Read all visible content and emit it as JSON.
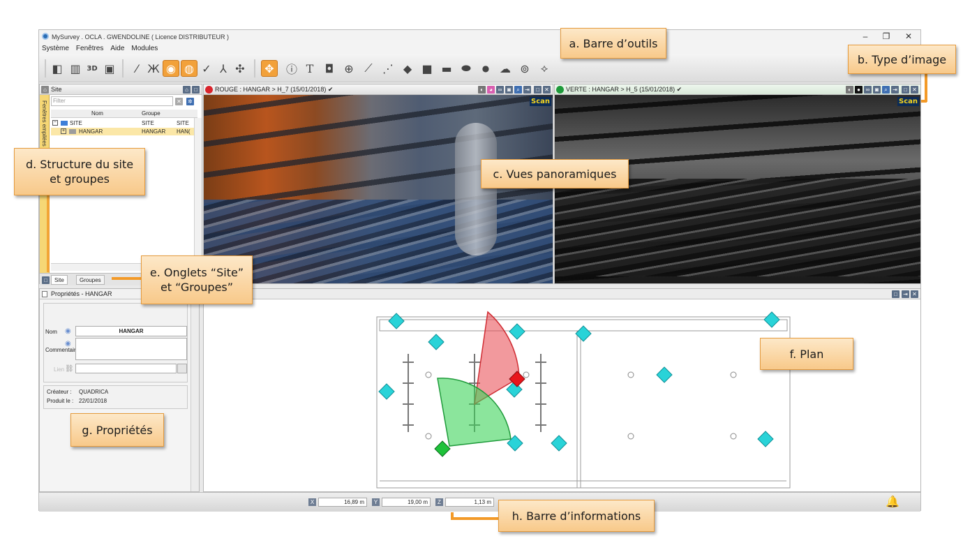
{
  "window": {
    "title": "MySurvey . OCLA . GWENDOLINE ( Licence DISTRIBUTEUR )",
    "controls": [
      "–",
      "❐",
      "✕"
    ]
  },
  "menu": [
    "Système",
    "Fenêtres",
    "Aide",
    "Modules"
  ],
  "site_panel": {
    "title": "Site",
    "strip_label": "Fenêtres empilées",
    "filter_placeholder": "Filter",
    "columns": [
      "Nom",
      "Groupe"
    ],
    "rows": [
      {
        "expander": "−",
        "name": "SITE",
        "group": "SITE",
        "extra": "SITE"
      },
      {
        "expander": "+",
        "name": "HANGAR",
        "group": "HANGAR",
        "extra": "HAN("
      }
    ],
    "tabs": [
      "Site",
      "Groupes"
    ]
  },
  "pano_left": {
    "title": "ROUGE : HANGAR > H_7 (15/01/2018) ✔",
    "badge": "Scan",
    "accent": "#d9242c"
  },
  "pano_right": {
    "title": "VERTE : HANGAR > H_5 (15/01/2018) ✔",
    "badge": "Scan",
    "accent": "#1e9a3a"
  },
  "properties": {
    "title": "Propriétés - HANGAR",
    "nom_label": "Nom",
    "nom_value": "HANGAR",
    "commentaire_label": "Commentaire",
    "lien_label": "Lien",
    "createur_label": "Créateur :",
    "createur_value": "QUADRICA",
    "produit_label": "Produit le :",
    "produit_value": "22/01/2018"
  },
  "status": {
    "x_label": "X",
    "x_value": "16,89 m",
    "y_label": "Y",
    "y_value": "19,00 m",
    "z_label": "Z",
    "z_value": "1,13 m"
  },
  "callouts": {
    "a": "a. Barre d’outils",
    "b": "b. Type d’image",
    "c": "c. Vues panoramiques",
    "d_line1": "d. Structure du site",
    "d_line2": "et groupes",
    "e_line1": "e. Onglets “Site”",
    "e_line2": "et “Groupes”",
    "f": "f. Plan",
    "g": "g. Propriétés",
    "h": "h. Barre d’informations"
  },
  "colors": {
    "callout_border": "#e59a3c",
    "connector": "#f39a28",
    "marker_cyan": "#29d3d8",
    "fov_red": "#e8464c",
    "fov_green": "#3ed35a"
  }
}
